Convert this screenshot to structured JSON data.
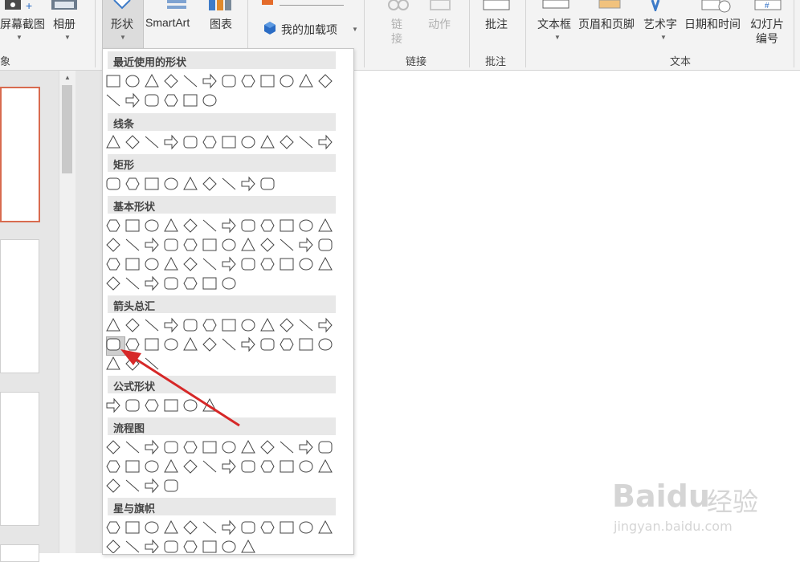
{
  "ribbon": {
    "buttons": [
      {
        "label": "屏幕截图"
      },
      {
        "label": "相册"
      },
      {
        "label": "形状"
      },
      {
        "label": "SmartArt"
      },
      {
        "label": "图表"
      },
      {
        "label": "我的加载项"
      },
      {
        "label": "链接"
      },
      {
        "label": "动作"
      },
      {
        "label": "批注"
      },
      {
        "label": "文本框"
      },
      {
        "label": "页眉和页脚"
      },
      {
        "label": "艺术字"
      },
      {
        "label": "日期和时间"
      },
      {
        "label": "幻灯片"
      },
      {
        "label": "编号"
      }
    ],
    "link_button_lines": [
      "链",
      "接"
    ],
    "groups": [
      "链接",
      "批注",
      "文本"
    ],
    "partial_group": "象"
  },
  "shapes_panel": {
    "sections": [
      "最近使用的形状",
      "线条",
      "矩形",
      "基本形状",
      "箭头总汇",
      "公式形状",
      "流程图",
      "星与旗帜"
    ]
  },
  "watermark": {
    "brand": "Baidu",
    "brand_cn": "经验",
    "url": "jingyan.baidu.com"
  },
  "colors": {
    "accent": "#d86b4f",
    "arrow": "#d62828",
    "selected_shape_bg": "#cfcfcf"
  }
}
